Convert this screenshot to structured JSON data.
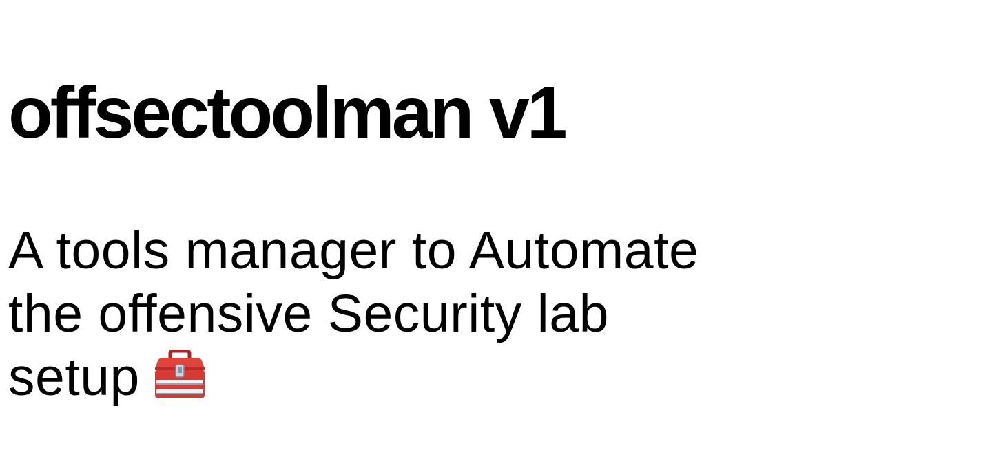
{
  "title": "offsectoolman v1",
  "tagline": {
    "line1": "A tools manager to Automate",
    "line2": "the offensive Security lab",
    "line3": "setup"
  },
  "icons": {
    "tagline_end": "toolbox-icon"
  },
  "colors": {
    "text": "#000000",
    "background": "#ffffff",
    "toolbox_red": "#d63a34"
  }
}
